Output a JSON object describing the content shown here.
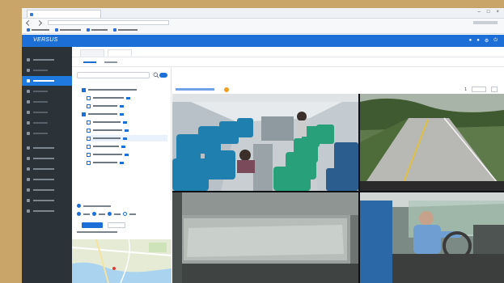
{
  "app": {
    "brand": "VERSUS"
  },
  "browser": {
    "tab_title": "",
    "controls": [
      "–",
      "□",
      "×"
    ]
  },
  "header": {
    "icons": [
      "bell-icon",
      "user-icon",
      "settings-icon",
      "power-icon"
    ]
  },
  "sidebar": {
    "items": [
      {
        "id": "menu-1",
        "active": false
      },
      {
        "id": "menu-2",
        "active": false
      },
      {
        "id": "menu-3",
        "active": true
      },
      {
        "id": "menu-4",
        "active": false
      },
      {
        "id": "menu-5",
        "active": false
      },
      {
        "id": "menu-6",
        "active": false
      },
      {
        "id": "menu-7",
        "active": false
      },
      {
        "id": "menu-8",
        "active": false
      },
      {
        "id": "menu-9",
        "active": false
      },
      {
        "id": "menu-10",
        "active": false
      },
      {
        "id": "menu-11",
        "active": false
      },
      {
        "id": "menu-12",
        "active": false
      },
      {
        "id": "menu-13",
        "active": false
      },
      {
        "id": "menu-14",
        "active": false
      },
      {
        "id": "menu-15",
        "active": false
      }
    ]
  },
  "video_toolbar": {
    "grid_label": "1"
  },
  "colors": {
    "primary": "#1d6fd8",
    "sidebar": "#2b3238",
    "accent": "#f0a020"
  }
}
